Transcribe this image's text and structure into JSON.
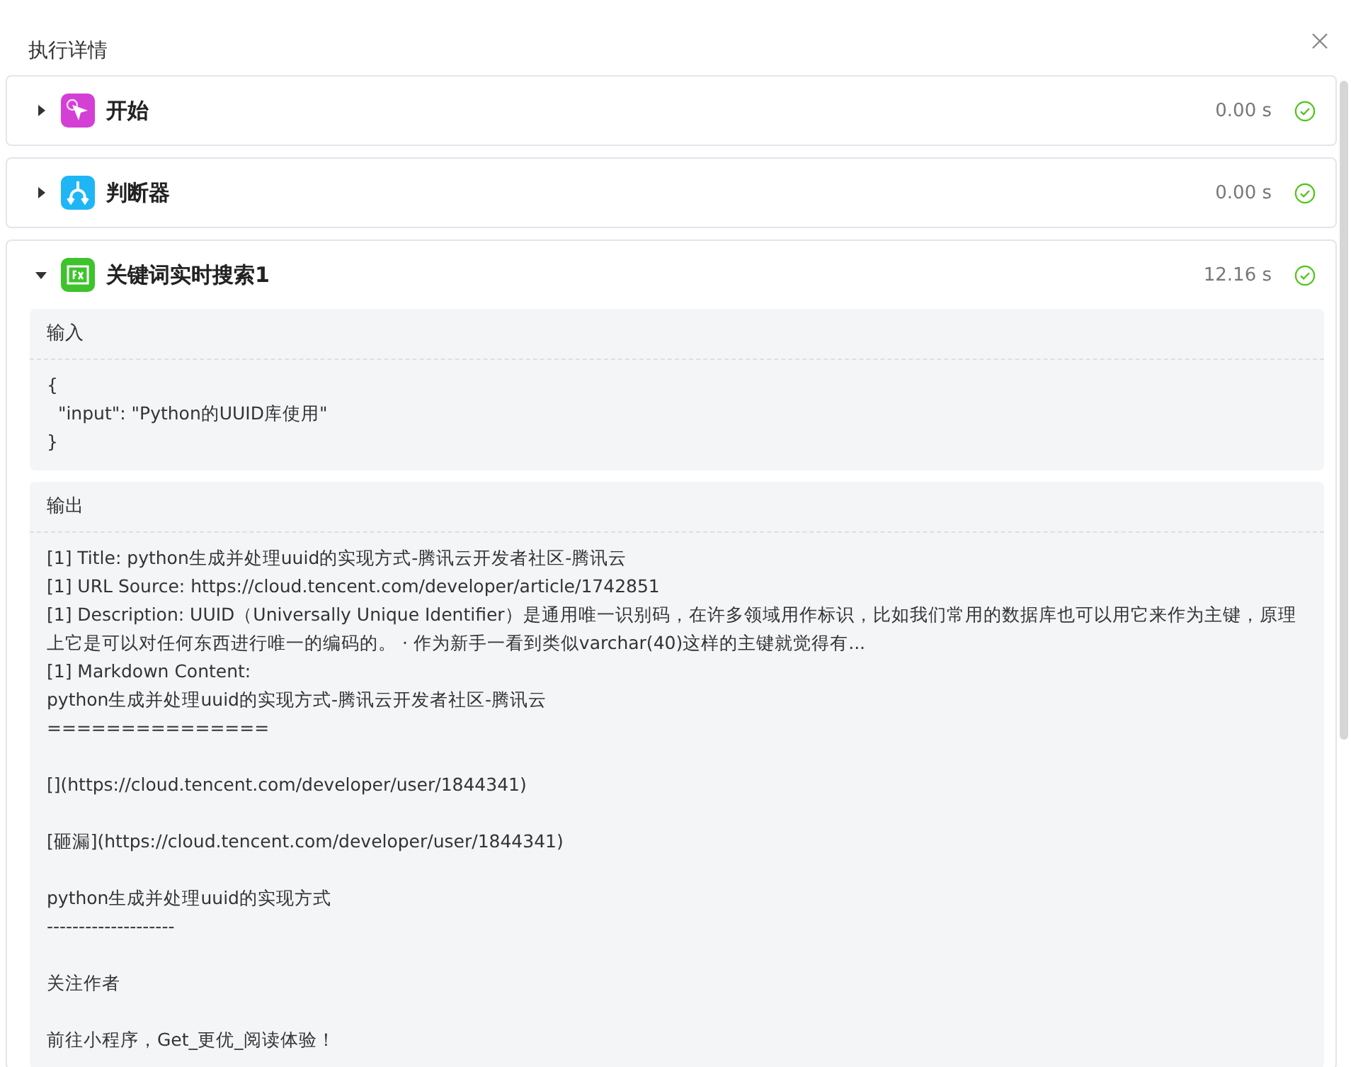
{
  "dialog": {
    "title": "执行详情"
  },
  "nodes": [
    {
      "name": "开始",
      "kind": "start",
      "color": "#d43fd6",
      "duration": "0.00 s",
      "expanded": false
    },
    {
      "name": "判断器",
      "kind": "condition",
      "color": "#1fb6f5",
      "duration": "0.00 s",
      "expanded": false
    },
    {
      "name": "关键词实时搜索1",
      "kind": "function",
      "color": "#3ec32c",
      "duration": "12.16 s",
      "expanded": true,
      "sections": [
        {
          "label": "输入",
          "blocks": [
            [
              "{",
              "  \"input\": \"Python的UUID库使用\"",
              "}"
            ]
          ]
        },
        {
          "label": "输出",
          "blocks": [
            [
              "[1] Title: python生成并处理uuid的实现方式-腾讯云开发者社区-腾讯云",
              "[1] URL Source: https://cloud.tencent.com/developer/article/1742851",
              "[1] Description: UUID（Universally Unique Identifier）是通用唯一识别码，在许多领域用作标识，比如我们常用的数据库也可以用它来作为主键，原理上它是可以对任何东西进行唯一的编码的。 · 作为新手一看到类似varchar(40)这样的主键就觉得有...",
              "[1] Markdown Content:",
              "python生成并处理uuid的实现方式-腾讯云开发者社区-腾讯云",
              "==============="
            ],
            [
              "[](https://cloud.tencent.com/developer/user/1844341)"
            ],
            [
              "[砸漏](https://cloud.tencent.com/developer/user/1844341)"
            ],
            [
              "python生成并处理uuid的实现方式",
              "--------------------"
            ],
            [
              "关注作者"
            ],
            [
              "前往小程序，Get_更优_阅读体验！"
            ]
          ]
        }
      ]
    }
  ]
}
